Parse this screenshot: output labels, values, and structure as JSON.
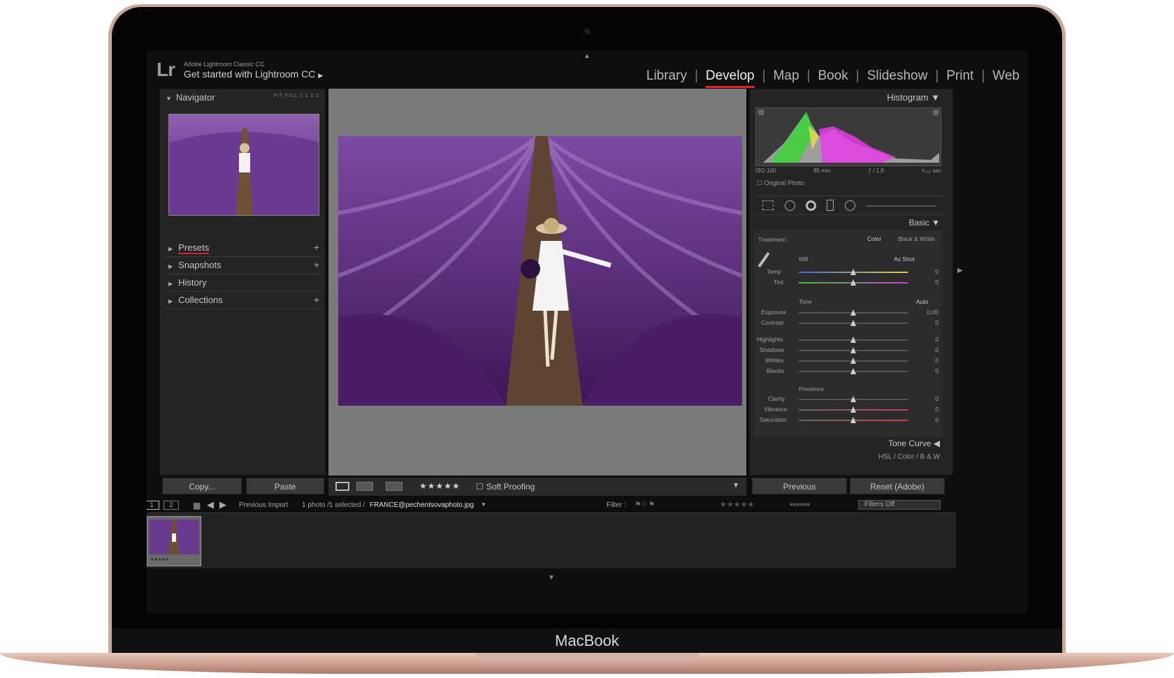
{
  "device": {
    "brand": "MacBook"
  },
  "identity": {
    "small": "Adobe Lightroom Classic CC",
    "main": "Get started with Lightroom CC",
    "logo": "Lr"
  },
  "modules": [
    "Library",
    "Develop",
    "Map",
    "Book",
    "Slideshow",
    "Print",
    "Web"
  ],
  "active_module": "Develop",
  "left_panel": {
    "navigator": "Navigator",
    "nav_options": "FIT  FILL  1:1  1:2",
    "sections": [
      {
        "label": "Presets",
        "has_plus": true
      },
      {
        "label": "Snapshots",
        "has_plus": true
      },
      {
        "label": "History",
        "has_plus": false
      },
      {
        "label": "Collections",
        "has_plus": true
      }
    ],
    "copy_label": "Copy...",
    "paste_label": "Paste"
  },
  "toolbar": {
    "stars": "★★★★★",
    "soft_proofing": "Soft Proofing"
  },
  "right_panel": {
    "histogram": "Histogram",
    "exif": {
      "iso": "ISO 100",
      "focal": "85 mm",
      "aperture": "ƒ / 1,8",
      "shutter": "¹⁄₃₂₀ sec"
    },
    "original_photo": "Original Photo",
    "basic": "Basic",
    "treatment_label": "Treatment :",
    "treatment_color": "Color",
    "treatment_bw": "Black & White",
    "wb_label": "WB :",
    "wb_value": "As Shot",
    "tone_label": "Tone",
    "auto_label": "Auto",
    "presence_label": "Presence",
    "sliders": [
      {
        "label": "Temp",
        "value": "0"
      },
      {
        "label": "Tint",
        "value": "0"
      },
      {
        "label": "Exposure",
        "value": "0,00"
      },
      {
        "label": "Contrast",
        "value": "0"
      },
      {
        "label": "Highlights",
        "value": "0"
      },
      {
        "label": "Shadows",
        "value": "0"
      },
      {
        "label": "Whites",
        "value": "0"
      },
      {
        "label": "Blacks",
        "value": "0"
      },
      {
        "label": "Clarity",
        "value": "0"
      },
      {
        "label": "Vibrance",
        "value": "0"
      },
      {
        "label": "Saturation",
        "value": "0"
      }
    ],
    "tone_curve": "Tone Curve",
    "hsl": "HSL / Color / B & W",
    "previous_label": "Previous",
    "reset_label": "Reset (Adobe)"
  },
  "filmstrip": {
    "page1": "1",
    "page2": "2",
    "source": "Previous Import",
    "count": "1 photo /1 selected /",
    "filename": "FRANCE@pechentsovaphoto.jpg",
    "filter_label": "Filter :",
    "filters_off": "Filters Off",
    "thumb_stars": "★★★★★"
  }
}
